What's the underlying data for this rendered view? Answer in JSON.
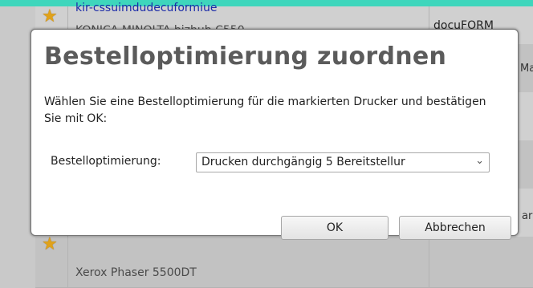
{
  "background": {
    "row1_link": "kir-cssuimdudecuformiue",
    "row1_text2": "KONICA MINOLTA bizhub C550",
    "row1_cell": "docuFORM",
    "frag_right_1": "Ma",
    "frag_right_2": "ar",
    "last_row_text": "Xerox Phaser 5500DT"
  },
  "dialog": {
    "title": "Bestelloptimierung zuordnen",
    "description": "Wählen Sie eine Bestelloptimierung für die markierten Drucker und bestätigen Sie mit OK:",
    "field_label": "Bestelloptimierung:",
    "select_value": "Drucken durchgängig 5 Bereitstellur",
    "ok_label": "OK",
    "cancel_label": "Abbrechen"
  },
  "icons": {
    "star": "★",
    "dropdown_arrow": "⌄"
  }
}
